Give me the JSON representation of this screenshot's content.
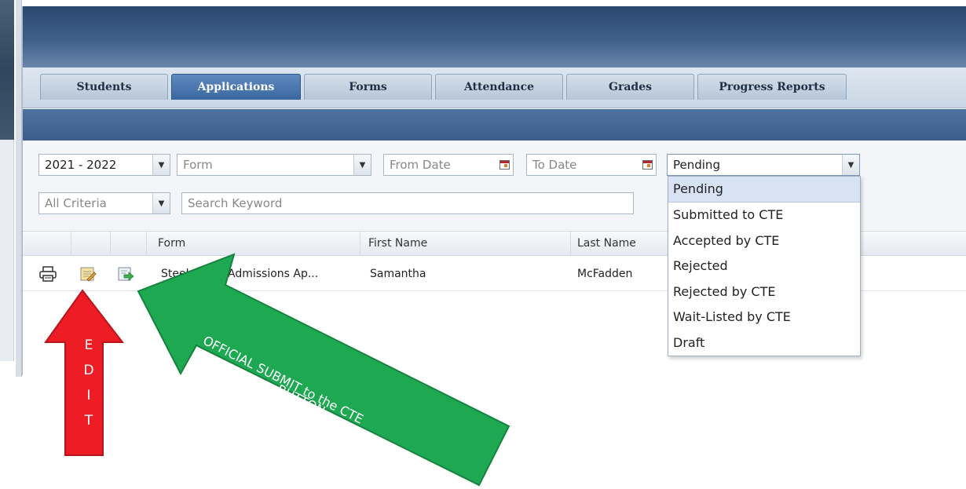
{
  "tabs": [
    {
      "label": "Students",
      "active": false
    },
    {
      "label": "Applications",
      "active": true
    },
    {
      "label": "Forms",
      "active": false
    },
    {
      "label": "Attendance",
      "active": false
    },
    {
      "label": "Grades",
      "active": false
    },
    {
      "label": "Progress Reports",
      "active": false
    }
  ],
  "filters": {
    "year": "2021 - 2022",
    "form_placeholder": "Form",
    "from_date_placeholder": "From Date",
    "to_date_placeholder": "To Date",
    "status": "Pending",
    "criteria": "All Criteria",
    "search_placeholder": "Search Keyword"
  },
  "status_options": [
    "Pending",
    "Submitted to CTE",
    "Accepted by CTE",
    "Rejected",
    "Rejected by CTE",
    "Wait-Listed by CTE",
    "Draft"
  ],
  "grid": {
    "columns": {
      "form": "Form",
      "first_name": "First Name",
      "last_name": "Last Name"
    },
    "rows": [
      {
        "form": "Steelcenter Admissions Ap...",
        "first_name": "Samantha",
        "last_name": "McFadden"
      }
    ]
  },
  "annotations": {
    "green_arrow_line1": "OFFICIAL  SUBMIT to the CTE",
    "green_arrow_line2": "BUTTON",
    "red_arrow_letters": [
      "E",
      "D",
      "I",
      "T"
    ]
  },
  "colors": {
    "header": "#2a476f",
    "active_tab": "#3b679f",
    "green_arrow": "#1ea851",
    "red_arrow": "#ee1c24"
  }
}
